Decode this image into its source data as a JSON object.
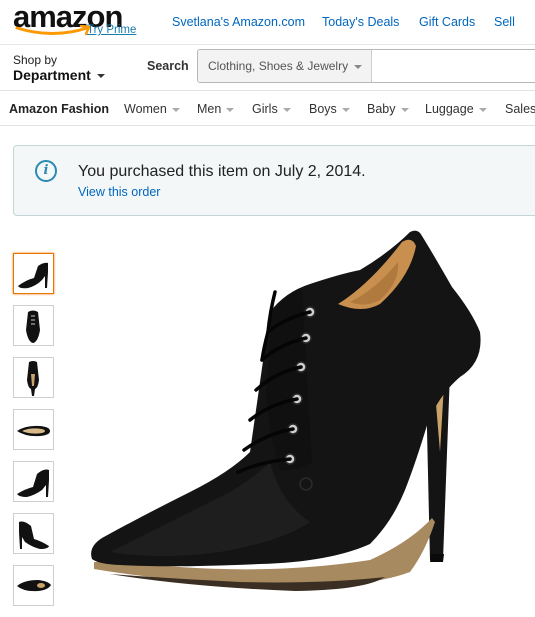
{
  "header": {
    "logo": "amazon",
    "try_prime": "Try Prime",
    "links": [
      "Svetlana's Amazon.com",
      "Today's Deals",
      "Gift Cards",
      "Sell"
    ]
  },
  "nav": {
    "shop_by": "Shop by",
    "department": "Department",
    "search_label": "Search",
    "search_category": "Clothing, Shoes & Jewelry",
    "search_value": ""
  },
  "subnav": {
    "items": [
      "Amazon Fashion",
      "Women",
      "Men",
      "Girls",
      "Boys",
      "Baby",
      "Luggage",
      "Sales"
    ]
  },
  "notice": {
    "text": "You purchased this item on July 2, 2014.",
    "link": "View this order"
  },
  "product": {
    "thumbnails": [
      "side view",
      "front view",
      "back view",
      "sole view",
      "side view",
      "side view",
      "top view"
    ],
    "selected_thumbnail": 0
  },
  "colors": {
    "brand_link": "#0066c0",
    "prime_link": "#1a7dae",
    "logo_smile": "#ff9900",
    "selected_thumb": "#e77600"
  }
}
